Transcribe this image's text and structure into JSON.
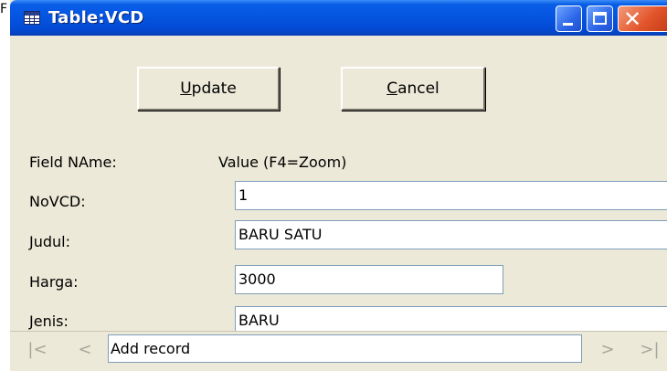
{
  "background": {
    "glyph": "F"
  },
  "window": {
    "title": "Table:VCD",
    "icon": "table-icon",
    "controls": {
      "minimize": "minimize-icon",
      "maximize": "maximize-icon",
      "close": "close-icon"
    }
  },
  "toolbar": {
    "update_accel": "U",
    "update_rest": "pdate",
    "cancel_accel": "C",
    "cancel_rest": "ancel"
  },
  "headers": {
    "field": "Field NAme:",
    "value": "Value (F4=Zoom)"
  },
  "fields": [
    {
      "label": "NoVCD:",
      "value": "1"
    },
    {
      "label": "Judul:",
      "value": "BARU SATU"
    },
    {
      "label": "Harga:",
      "value": "3000"
    },
    {
      "label": "Jenis:",
      "value": "BARU"
    }
  ],
  "nav": {
    "first": "|<",
    "prev": "<",
    "status": "Add record",
    "next": ">",
    "last": ">|"
  },
  "colors": {
    "titlebar": "#0454e0",
    "window_bg": "#ece9d8",
    "close_button": "#e2552c"
  }
}
